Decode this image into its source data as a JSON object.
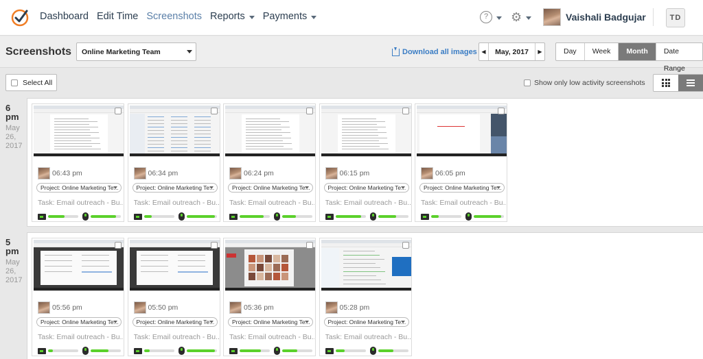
{
  "nav": {
    "items": [
      {
        "label": "Dashboard",
        "active": false,
        "dropdown": false
      },
      {
        "label": "Edit Time",
        "active": false,
        "dropdown": false
      },
      {
        "label": "Screenshots",
        "active": true,
        "dropdown": false
      },
      {
        "label": "Reports",
        "active": false,
        "dropdown": true
      },
      {
        "label": "Payments",
        "active": false,
        "dropdown": true
      }
    ],
    "help_icon": "?",
    "user_name": "Vaishali Badgujar",
    "initials": "TD"
  },
  "toolbar": {
    "page_title": "Screenshots",
    "team": "Online Marketing Team",
    "download_label": "Download all images",
    "month_label": "May, 2017",
    "range_buttons": [
      {
        "label": "Day",
        "active": false
      },
      {
        "label": "Week",
        "active": false
      },
      {
        "label": "Month",
        "active": true
      },
      {
        "label": "Date Range",
        "active": false
      }
    ],
    "select_all": "Select All",
    "low_activity": "Show only low activity screenshots"
  },
  "colors": {
    "accent": "#5a7fa8",
    "link": "#3b7dc4",
    "activity": "#5bd12b",
    "logo": "#f07d24"
  },
  "blocks": [
    {
      "hour": "6",
      "ampm": "pm",
      "date_month": "May",
      "date_day": "26,",
      "date_year": "2017",
      "cards": [
        {
          "time": "06:43 pm",
          "project": "Project: Online Marketing Te...",
          "task": "Task: Email outreach - Bu...",
          "kb": 0.55,
          "mouse": 0.85,
          "style": "doc"
        },
        {
          "time": "06:34 pm",
          "project": "Project: Online Marketing Te...",
          "task": "Task: Email outreach - Bu...",
          "kb": 0.25,
          "mouse": 0.95,
          "style": "explorer"
        },
        {
          "time": "06:24 pm",
          "project": "Project: Online Marketing Te...",
          "task": "Task: Email outreach - Bu...",
          "kb": 0.8,
          "mouse": 0.45,
          "style": "doc"
        },
        {
          "time": "06:15 pm",
          "project": "Project: Online Marketing Te...",
          "task": "Task: Email outreach - Bu...",
          "kb": 0.85,
          "mouse": 0.6,
          "style": "doc"
        },
        {
          "time": "06:05 pm",
          "project": "Project: Online Marketing Te...",
          "task": "Task: Email outreach - Bu...",
          "kb": 0.25,
          "mouse": 0.9,
          "style": "mixed"
        }
      ]
    },
    {
      "hour": "5",
      "ampm": "pm",
      "date_month": "May",
      "date_day": "26,",
      "date_year": "2017",
      "cards": [
        {
          "time": "05:56 pm",
          "project": "Project: Online Marketing Te...",
          "task": "Task: Email outreach - Bu...",
          "kb": 0.15,
          "mouse": 0.6,
          "style": "browser"
        },
        {
          "time": "05:50 pm",
          "project": "Project: Online Marketing Te...",
          "task": "Task: Email outreach - Bu...",
          "kb": 0.2,
          "mouse": 0.95,
          "style": "browser"
        },
        {
          "time": "05:36 pm",
          "project": "Project: Online Marketing Te...",
          "task": "Task: Email outreach - Bu...",
          "kb": 0.7,
          "mouse": 0.5,
          "style": "photos"
        },
        {
          "time": "05:28 pm",
          "project": "Project: Online Marketing Te...",
          "task": "Task: Email outreach - Bu...",
          "kb": 0.3,
          "mouse": 0.5,
          "style": "chat"
        }
      ]
    }
  ]
}
